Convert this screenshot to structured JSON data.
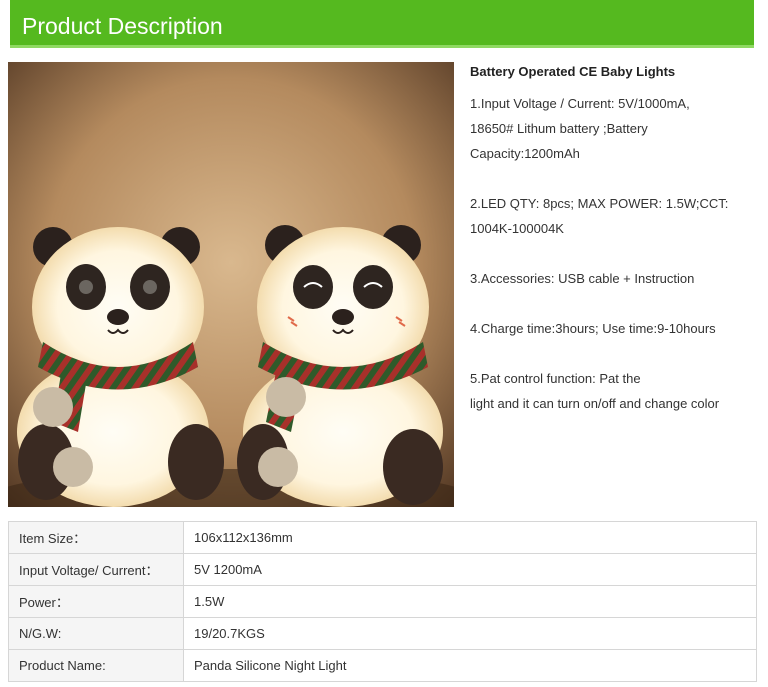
{
  "header": {
    "title": "Product Description"
  },
  "description": {
    "title": "Battery Operated CE Baby Lights",
    "lines": [
      " 1.Input Voltage / Current: 5V/1000mA,",
      "18650# Lithum battery ;Battery",
      "Capacity:1200mAh",
      "2.LED QTY: 8pcs; MAX POWER: 1.5W;CCT:",
      "1004K-100004K",
      "3.Accessories: USB cable + Instruction",
      "4.Charge time:3hours; Use time:9-10hours",
      "5.Pat control function: Pat the",
      "light and it can turn on/off and change color"
    ]
  },
  "specs": [
    {
      "label": "Item Size：",
      "value": "106x112x136mm"
    },
    {
      "label": "Input Voltage/ Current：",
      "value": "5V 1200mA"
    },
    {
      "label": "Power：",
      "value": "1.5W"
    },
    {
      "label": "N/G.W:",
      "value": "19/20.7KGS"
    },
    {
      "label": "Product Name:",
      "value": "Panda Silicone Night Light"
    }
  ],
  "photo": {
    "icon": "panda-night-light-photo"
  }
}
